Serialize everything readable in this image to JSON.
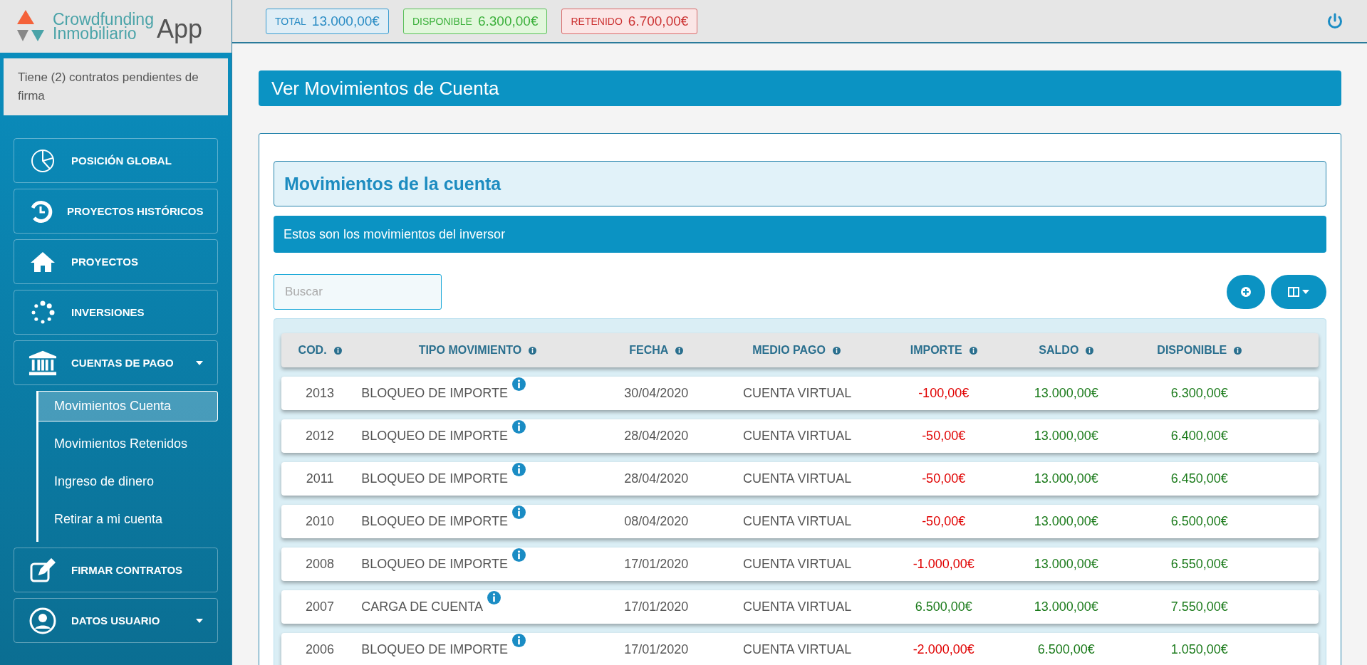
{
  "logo": {
    "line1": "Crowdfunding",
    "line2": "Inmobiliario",
    "app": "App"
  },
  "balances": [
    {
      "kind": "total",
      "label": "TOTAL",
      "value": "13.000,00€"
    },
    {
      "kind": "available",
      "label": "DISPONIBLE",
      "value": "6.300,00€"
    },
    {
      "kind": "held",
      "label": "RETENIDO",
      "value": "6.700,00€"
    }
  ],
  "notice": "Tiene (2) contratos pendientes de firma",
  "sidebar": {
    "items": [
      {
        "label": "POSICIÓN GLOBAL"
      },
      {
        "label": "PROYECTOS HISTÓRICOS"
      },
      {
        "label": "PROYECTOS"
      },
      {
        "label": "INVERSIONES"
      },
      {
        "label": "CUENTAS DE PAGO",
        "caret": true,
        "children": [
          {
            "label": "Movimientos Cuenta",
            "selected": true
          },
          {
            "label": "Movimientos Retenidos",
            "selected": false
          },
          {
            "label": "Ingreso de dinero",
            "selected": false
          },
          {
            "label": "Retirar a mi cuenta",
            "selected": false
          }
        ]
      },
      {
        "label": "FIRMAR CONTRATOS"
      },
      {
        "label": "DATOS USUARIO",
        "caret": true
      }
    ]
  },
  "page_title": "Ver Movimientos de Cuenta",
  "card": {
    "heading": "Movimientos de la cuenta",
    "subtitle": "Estos son los movimientos del inversor",
    "search": {
      "placeholder": "Buscar"
    }
  },
  "table": {
    "columns": [
      "COD.",
      "TIPO MOVIMIENTO",
      "FECHA",
      "MEDIO PAGO",
      "IMPORTE",
      "SALDO",
      "DISPONIBLE"
    ],
    "rows": [
      {
        "cod": "2013",
        "tipo": "BLOQUEO DE IMPORTE",
        "fecha": "30/04/2020",
        "medio": "CUENTA VIRTUAL",
        "importe": "-100,00€",
        "kind": "debit",
        "saldo": "13.000,00€",
        "disponible": "6.300,00€"
      },
      {
        "cod": "2012",
        "tipo": "BLOQUEO DE IMPORTE",
        "fecha": "28/04/2020",
        "medio": "CUENTA VIRTUAL",
        "importe": "-50,00€",
        "kind": "debit",
        "saldo": "13.000,00€",
        "disponible": "6.400,00€"
      },
      {
        "cod": "2011",
        "tipo": "BLOQUEO DE IMPORTE",
        "fecha": "28/04/2020",
        "medio": "CUENTA VIRTUAL",
        "importe": "-50,00€",
        "kind": "debit",
        "saldo": "13.000,00€",
        "disponible": "6.450,00€"
      },
      {
        "cod": "2010",
        "tipo": "BLOQUEO DE IMPORTE",
        "fecha": "08/04/2020",
        "medio": "CUENTA VIRTUAL",
        "importe": "-50,00€",
        "kind": "debit",
        "saldo": "13.000,00€",
        "disponible": "6.500,00€"
      },
      {
        "cod": "2008",
        "tipo": "BLOQUEO DE IMPORTE",
        "fecha": "17/01/2020",
        "medio": "CUENTA VIRTUAL",
        "importe": "-1.000,00€",
        "kind": "debit",
        "saldo": "13.000,00€",
        "disponible": "6.550,00€"
      },
      {
        "cod": "2007",
        "tipo": "CARGA DE CUENTA",
        "fecha": "17/01/2020",
        "medio": "CUENTA VIRTUAL",
        "importe": "6.500,00€",
        "kind": "credit",
        "saldo": "13.000,00€",
        "disponible": "7.550,00€"
      },
      {
        "cod": "2006",
        "tipo": "BLOQUEO DE IMPORTE",
        "fecha": "17/01/2020",
        "medio": "CUENTA VIRTUAL",
        "importe": "-2.000,00€",
        "kind": "debit",
        "saldo": "6.500,00€",
        "disponible": "1.050,00€"
      }
    ]
  }
}
